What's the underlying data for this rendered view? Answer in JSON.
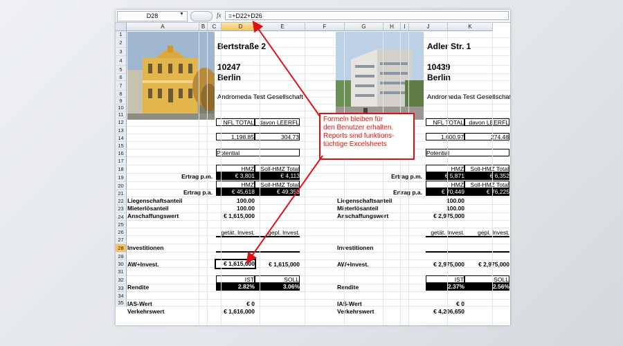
{
  "formula_bar": {
    "name_box": "D28",
    "fx_label": "fx",
    "formula": "=+D22+D26"
  },
  "columns": [
    "A",
    "B",
    "C",
    "D",
    "E",
    "F",
    "G",
    "H",
    "I",
    "J",
    "K"
  ],
  "rows": [
    "1",
    "2",
    "3",
    "4",
    "5",
    "6",
    "7",
    "8",
    "9",
    "10",
    "11",
    "12",
    "13",
    "14",
    "15",
    "16",
    "17",
    "18",
    "19",
    "20",
    "21",
    "22",
    "23",
    "24",
    "25",
    "26",
    "27",
    "28",
    "29",
    "30",
    "31",
    "32",
    "33",
    "34",
    "35"
  ],
  "selected": {
    "column": "D",
    "row": "28"
  },
  "left": {
    "street": "Bertstraße 2",
    "zip": "10247",
    "city": "Berlin",
    "company": "Andromeda Test Gesellschaft",
    "nfl_total_header": "NFL TOTAL",
    "leerfl_header": "davon LEERFL",
    "nfl_total": "1,198.85",
    "leerfl": "304.73",
    "potential": "Potential",
    "hmz_header": "HMZ",
    "soll_hmz_header": "Soll-HMZ Total",
    "ertrag_pm_label": "Ertrag p.m.",
    "ertrag_pm_hmz": "€ 3,801",
    "ertrag_pm_soll": "€ 4,113",
    "hmz_header2": "HMZ",
    "soll_hmz_header2": "Soll-HMZ Total",
    "ertrag_pa_label": "Ertrag p.a.",
    "ertrag_pa_hmz": "€ 45,618",
    "ertrag_pa_soll": "€ 49,358",
    "liegenschaft_label": "Liegenschaftsanteil",
    "liegenschaft": "100.00",
    "mieterlos_label": "Mieterlösanteil",
    "mieterlos": "100.00",
    "anschaffung_label": "Anschaffungswert",
    "anschaffung": "€ 1,615,000",
    "getaet_header": "getät. Invest.",
    "gepl_header": "gepl. Invest.",
    "investitionen_label": "Investitionen",
    "aw_label": "AW+Invest.",
    "aw_ist": "€ 1,615,000",
    "aw_soll": "€ 1,615,000",
    "ist_header": "IST",
    "soll_header": "SOLL",
    "rendite_label": "Rendite",
    "rendite_ist": "2.82%",
    "rendite_soll": "3.06%",
    "ias_label": "IAS-Wert",
    "ias": "€ 0",
    "verkehr_label": "Verkehrswert",
    "verkehr": "€ 1,616,000"
  },
  "right": {
    "street": "Adler Str. 1",
    "zip": "10439",
    "city": "Berlin",
    "company": "Andromeda Test Gesellschaft",
    "nfl_total_header": "NFL TOTAL",
    "leerfl_header": "davon LEERFL",
    "nfl_total": "1,600.97",
    "leerfl": "274.48",
    "potential": "Potential",
    "hmz_header": "HMZ",
    "soll_hmz_header": "Soll-HMZ Total",
    "ertrag_pm_label": "Ertrag p.m.",
    "ertrag_pm_hmz": "€ 5,871",
    "ertrag_pm_soll": "€ 6,352",
    "hmz_header2": "HMZ",
    "soll_hmz_header2": "Soll-HMZ Total",
    "ertrag_pa_label": "Ertrag p.a.",
    "ertrag_pa_hmz": "€ 70,449",
    "ertrag_pa_soll": "€ 76,225",
    "liegenschaft_label": "Liegenschaftsanteil",
    "liegenschaft": "100.00",
    "mieterlos_label": "Mieterlösanteil",
    "mieterlos": "100.00",
    "anschaffung_label": "Anschaffungswert",
    "anschaffung": "€ 2,975,000",
    "getaet_header": "getät. Invest.",
    "gepl_header": "gepl. Invest.",
    "investitionen_label": "Investitionen",
    "aw_label": "AW+Invest.",
    "aw_ist": "€ 2,975,000",
    "aw_soll": "€ 2,975,000",
    "ist_header": "IST",
    "soll_header": "SOLL",
    "rendite_label": "Rendite",
    "rendite_ist": "2.37%",
    "rendite_soll": "2.56%",
    "ias_label": "IAS-Wert",
    "ias": "€ 0",
    "verkehr_label": "Verkehrswert",
    "verkehr": "€ 4,206,650"
  },
  "callout": {
    "line1": "Formeln bleiben für",
    "line2": "den Benutzer erhalten.",
    "line3": "Reports sind funktions-",
    "line4": "tüchtige Excelsheets"
  },
  "colors": {
    "accent": "#e01010",
    "selection": "#f6c45f"
  }
}
